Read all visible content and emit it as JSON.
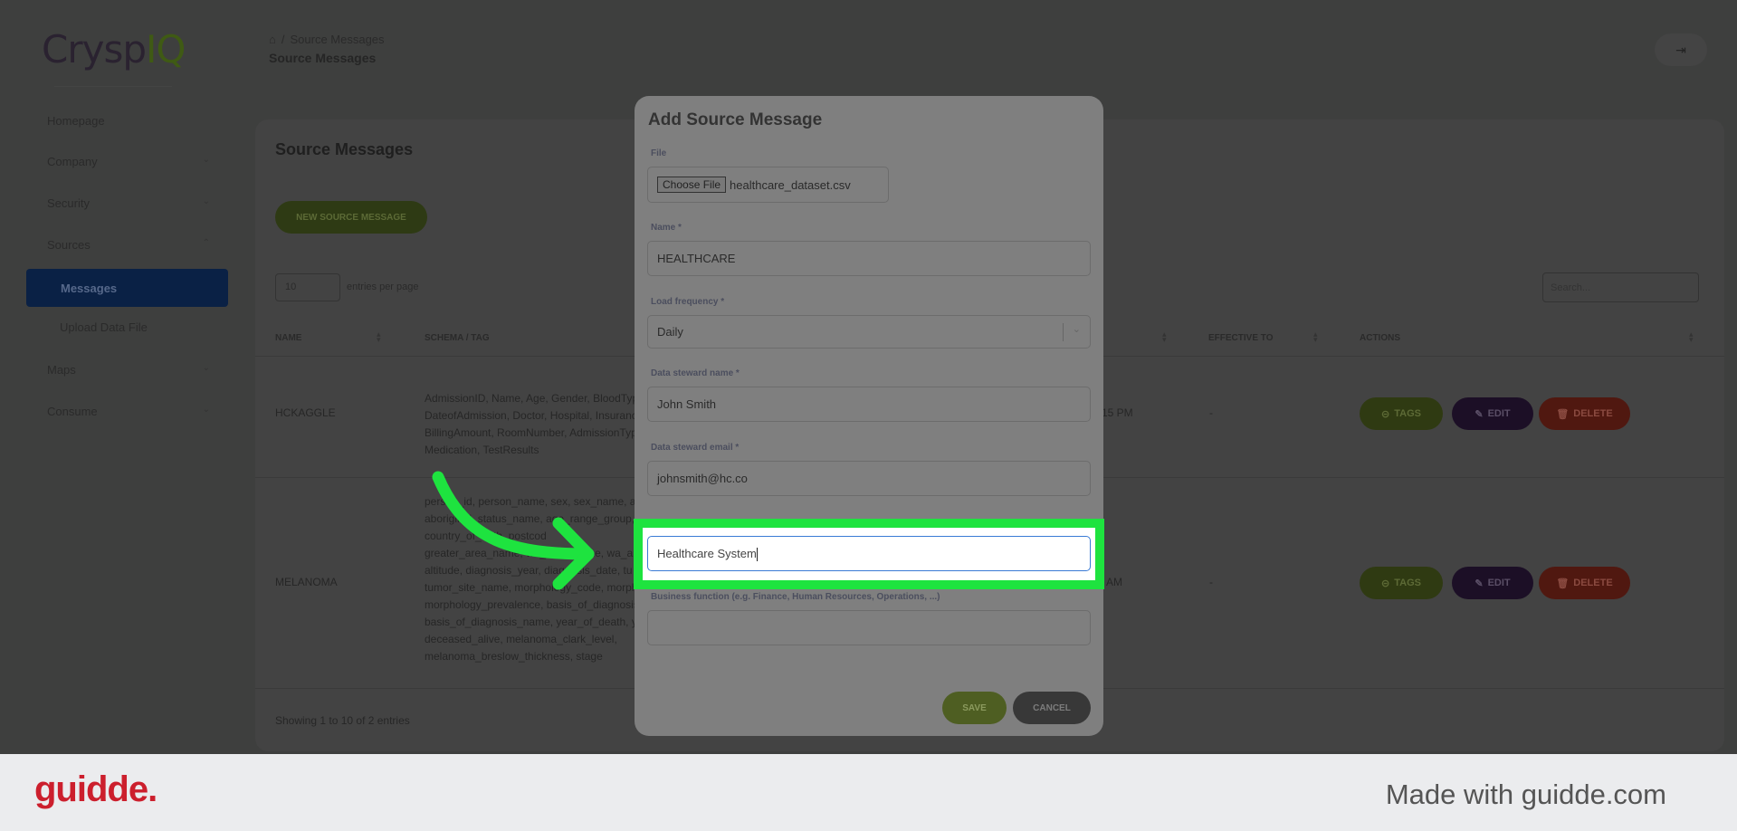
{
  "brand": {
    "logo_text": "CryspIQ"
  },
  "breadcrumb": {
    "current": "Source Messages",
    "title": "Source Messages"
  },
  "sidebar": {
    "items": [
      {
        "label": "Homepage"
      },
      {
        "label": "Company"
      },
      {
        "label": "Security"
      },
      {
        "label": "Sources"
      },
      {
        "label": "Messages"
      },
      {
        "label": "Upload Data File"
      },
      {
        "label": "Maps"
      },
      {
        "label": "Consume"
      }
    ]
  },
  "card": {
    "title": "Source Messages",
    "new_button": "NEW SOURCE MESSAGE",
    "entries_value": "10",
    "entries_label": "entries per page",
    "search_placeholder": "Search...",
    "columns": {
      "name": "NAME",
      "schema": "SCHEMA / TAG",
      "effective_to": "EFFECTIVE TO",
      "actions": "ACTIONS"
    },
    "rows": [
      {
        "name": "HCKAGGLE",
        "schema": [
          "AdmissionID, Name, Age, Gender, BloodType",
          "DateofAdmission, Doctor, Hospital, Insuranc",
          "BillingAmount, RoomNumber, AdmissionTyp",
          "Medication, TestResults"
        ],
        "date_fragment": "15 PM",
        "effective_to": "-"
      },
      {
        "name": "MELANOMA",
        "schema": [
          "person_id, person_name, sex, sex_name, ab",
          "aboriginal_status_name, age_range_group, c",
          "country_of_birth, postcod",
          "greater_area_name, wa_area_name, wa_are",
          "altitude, diagnosis_year, diagnosis_date, tu",
          "tumor_site_name, morphology_code, morph",
          "morphology_prevalence, basis_of_diagnosis",
          "basis_of_diagnosis_name, year_of_death, ye",
          "deceased_alive, melanoma_clark_level,",
          "melanoma_breslow_thickness, stage"
        ],
        "date_fragment": "AM",
        "effective_to": "-"
      }
    ],
    "actions": {
      "tags": "TAGS",
      "edit": "EDIT",
      "delete": "DELETE"
    },
    "showing": "Showing 1 to 10 of 2 entries"
  },
  "modal": {
    "title": "Add Source Message",
    "file_label": "File",
    "choose_file": "Choose File",
    "file_name": "healthcare_dataset.csv",
    "name_label": "Name *",
    "name_value": "HEALTHCARE",
    "freq_label": "Load frequency *",
    "freq_value": "Daily",
    "steward_name_label": "Data steward name *",
    "steward_name_value": "John Smith",
    "steward_email_label": "Data steward email *",
    "steward_email_value": "johnsmith@hc.co",
    "system_value": "Healthcare System",
    "business_label": "Business function (e.g. Finance, Human Resources, Operations, ...)",
    "business_value": "",
    "save": "SAVE",
    "cancel": "CANCEL"
  },
  "footer": {
    "brand": "guidde.",
    "tagline": "Made with guidde.com"
  },
  "colors": {
    "highlight": "#1ee33f",
    "brand_red": "#cc1f2d",
    "active_nav": "#0a2145"
  }
}
